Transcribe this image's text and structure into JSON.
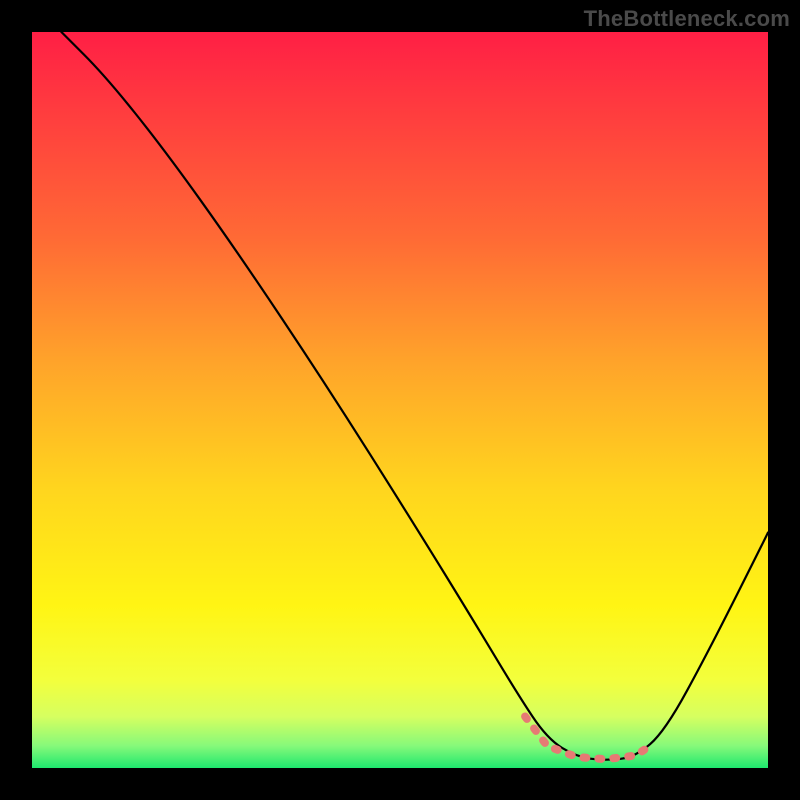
{
  "watermark": "TheBottleneck.com",
  "gradient": {
    "stops": [
      {
        "offset": "0%",
        "color": "#ff1f45"
      },
      {
        "offset": "10%",
        "color": "#ff3a3f"
      },
      {
        "offset": "28%",
        "color": "#ff6a35"
      },
      {
        "offset": "45%",
        "color": "#ffa42a"
      },
      {
        "offset": "62%",
        "color": "#ffd51e"
      },
      {
        "offset": "78%",
        "color": "#fff514"
      },
      {
        "offset": "88%",
        "color": "#f3ff3c"
      },
      {
        "offset": "93%",
        "color": "#d6ff60"
      },
      {
        "offset": "97%",
        "color": "#86f97a"
      },
      {
        "offset": "100%",
        "color": "#1ee86e"
      }
    ]
  },
  "chart_data": {
    "type": "line",
    "title": "",
    "xlabel": "",
    "ylabel": "",
    "xlim": [
      0,
      100
    ],
    "ylim": [
      0,
      100
    ],
    "series": [
      {
        "name": "curve",
        "points": [
          {
            "x": 4,
            "y": 100
          },
          {
            "x": 10,
            "y": 94
          },
          {
            "x": 18,
            "y": 84
          },
          {
            "x": 28,
            "y": 70
          },
          {
            "x": 40,
            "y": 52
          },
          {
            "x": 52,
            "y": 33
          },
          {
            "x": 60,
            "y": 20
          },
          {
            "x": 66,
            "y": 10
          },
          {
            "x": 70,
            "y": 4
          },
          {
            "x": 74,
            "y": 1.5
          },
          {
            "x": 78,
            "y": 1
          },
          {
            "x": 82,
            "y": 1.5
          },
          {
            "x": 86,
            "y": 5
          },
          {
            "x": 92,
            "y": 16
          },
          {
            "x": 100,
            "y": 32
          }
        ]
      },
      {
        "name": "highlight-segment",
        "color": "#e67a74",
        "points": [
          {
            "x": 67,
            "y": 7
          },
          {
            "x": 70,
            "y": 3
          },
          {
            "x": 74,
            "y": 1.5
          },
          {
            "x": 78,
            "y": 1.2
          },
          {
            "x": 82,
            "y": 1.7
          },
          {
            "x": 84,
            "y": 3
          }
        ]
      }
    ]
  }
}
